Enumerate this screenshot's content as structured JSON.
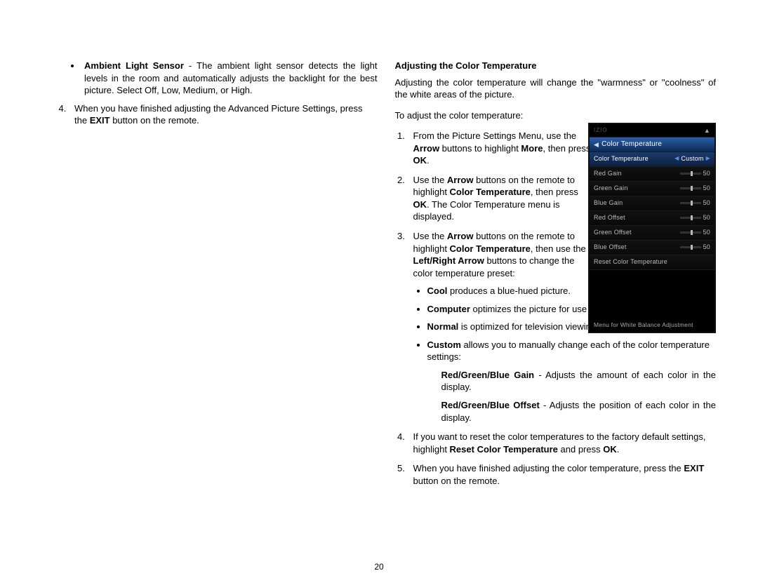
{
  "page_number": "20",
  "left": {
    "bullet_bold": "Ambient Light Sensor",
    "bullet_rest": " - The ambient light sensor detects the light levels in the room and automatically adjusts the backlight for the best picture. Select Off, Low, Medium, or High.",
    "step4_a": "When you have finished adjusting the Advanced Picture Settings, press the ",
    "step4_b": "EXIT",
    "step4_c": " button on the remote."
  },
  "right": {
    "heading": "Adjusting the Color Temperature",
    "intro": "Adjusting the color temperature will change the \"warmness\" or \"coolness\" of the white areas of the picture.",
    "lead": "To adjust the color temperature:",
    "s1_a": "From the Picture Settings Menu, use the ",
    "s1_b": "Arrow",
    "s1_c": " buttons to highlight ",
    "s1_d": "More",
    "s1_e": ", then press ",
    "s1_f": "OK",
    "s1_g": ".",
    "s2_a": "Use the ",
    "s2_b": "Arrow",
    "s2_c": " buttons on the remote to highlight ",
    "s2_d": "Color Temperature",
    "s2_e": ", then press ",
    "s2_f": "OK",
    "s2_g": ". The Color Temperature menu is displayed.",
    "s3_a": "Use the ",
    "s3_b": "Arrow",
    "s3_c": " buttons on the remote to highlight ",
    "s3_d": "Color Temperature",
    "s3_e": ", then use the ",
    "s3_f": "Left/Right Arrow",
    "s3_g": " buttons to change the color temperature preset:",
    "p_cool_b": "Cool",
    "p_cool_t": " produces a blue-hued picture.",
    "p_comp_b": "Computer",
    "p_comp_t": " optimizes the picture for use as a PC monitor.",
    "p_norm_b": "Normal",
    "p_norm_t": " is optimized for television viewing.",
    "p_cust_b": "Custom",
    "p_cust_t": " allows you to manually change each of the color temperature settings:",
    "gain_b": "Red/Green/Blue Gain",
    "gain_t": " - Adjusts the amount of each color in the display.",
    "off_b": "Red/Green/Blue Offset",
    "off_t": " - Adjusts the position of each color in the display.",
    "s4_a": "If you want to reset the color temperatures to the factory default settings, highlight ",
    "s4_b": "Reset Color Temperature",
    "s4_c": " and press ",
    "s4_d": "OK",
    "s4_e": ".",
    "s5_a": "When you have finished adjusting the color temperature, press the ",
    "s5_b": "EXIT",
    "s5_c": " button on the remote."
  },
  "tv": {
    "logo": "IZIO",
    "title": "Color Temperature",
    "mode_label": "Color Temperature",
    "mode_value": "Custom",
    "rows": [
      {
        "label": "Red Gain",
        "val": "50"
      },
      {
        "label": "Green Gain",
        "val": "50"
      },
      {
        "label": "Blue Gain",
        "val": "50"
      },
      {
        "label": "Red Offset",
        "val": "50"
      },
      {
        "label": "Green Offset",
        "val": "50"
      },
      {
        "label": "Blue Offset",
        "val": "50"
      }
    ],
    "reset": "Reset Color Temperature",
    "footer": "Menu for White Balance Adjustment"
  }
}
